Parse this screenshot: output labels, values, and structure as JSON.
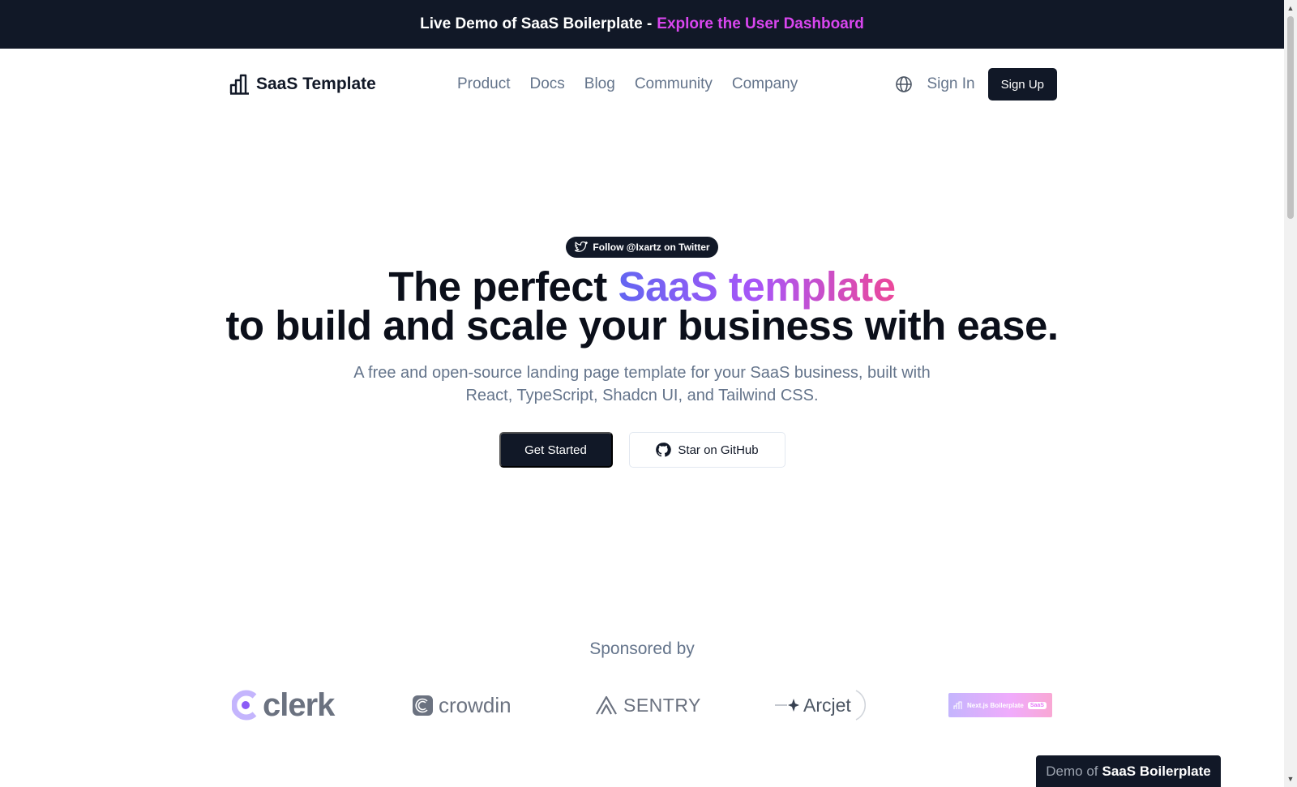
{
  "banner": {
    "text": "Live Demo of SaaS Boilerplate -",
    "link": "Explore the User Dashboard"
  },
  "nav": {
    "brand": "SaaS Template",
    "links": [
      "Product",
      "Docs",
      "Blog",
      "Community",
      "Company"
    ],
    "sign_in": "Sign In",
    "sign_up": "Sign Up"
  },
  "hero": {
    "badge": "Follow @Ixartz on Twitter",
    "title_start": "The perfect",
    "title_accent": "SaaS template",
    "title_end": "to build and scale your business with ease.",
    "subtitle": "A free and open-source landing page template for your SaaS business, built with React, TypeScript, Shadcn UI, and Tailwind CSS.",
    "primary_button": "Get Started",
    "secondary_button": "Star on GitHub"
  },
  "sponsors": {
    "heading": "Sponsored by",
    "logos": {
      "clerk": "clerk",
      "crowdin": "crowdin",
      "sentry": "SENTRY",
      "arcjet": "Arcjet",
      "nextjs": "Next.js Boilerplate",
      "nextjs_chip": "SaaS"
    }
  },
  "demo_pill": {
    "prefix": "Demo of",
    "name": "SaaS Boilerplate"
  },
  "colors": {
    "dark": "#111827",
    "accent_link": "#d946ef",
    "gradient_start": "#6366f1",
    "gradient_end": "#ec4899",
    "muted_text": "#64748b"
  },
  "icons": [
    "bar-chart-icon",
    "globe-icon",
    "twitter-icon",
    "github-icon",
    "clerk-logo-icon",
    "crowdin-logo-icon",
    "sentry-logo-icon",
    "arcjet-logo-icon"
  ]
}
